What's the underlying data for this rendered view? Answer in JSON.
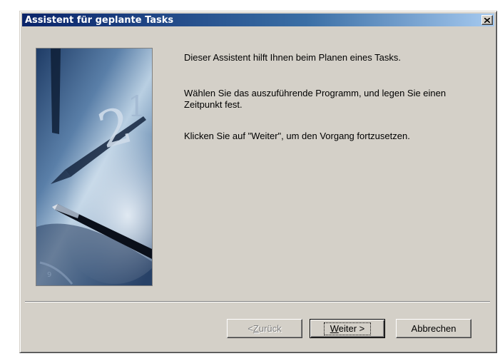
{
  "window": {
    "title": "Assistent für geplante Tasks",
    "close_icon": "close-icon"
  },
  "content": {
    "intro": "Dieser Assistent hilft Ihnen beim Planen eines Tasks.",
    "instruction": "Wählen Sie das auszuführende Programm, und legen Sie einen Zeitpunkt fest.",
    "continue_hint": "Klicken Sie auf \"Weiter\", um den Vorgang fortzusetzen."
  },
  "buttons": {
    "back": {
      "prefix": "< ",
      "accel": "Z",
      "rest": "urück",
      "enabled": false
    },
    "next": {
      "accel": "W",
      "rest": "eiter >",
      "enabled": true
    },
    "cancel": {
      "label": "Abbrechen",
      "enabled": true
    }
  },
  "colors": {
    "titlebar_start": "#0a246a",
    "titlebar_end": "#a6caf0",
    "dialog_bg": "#d4d0c8"
  }
}
